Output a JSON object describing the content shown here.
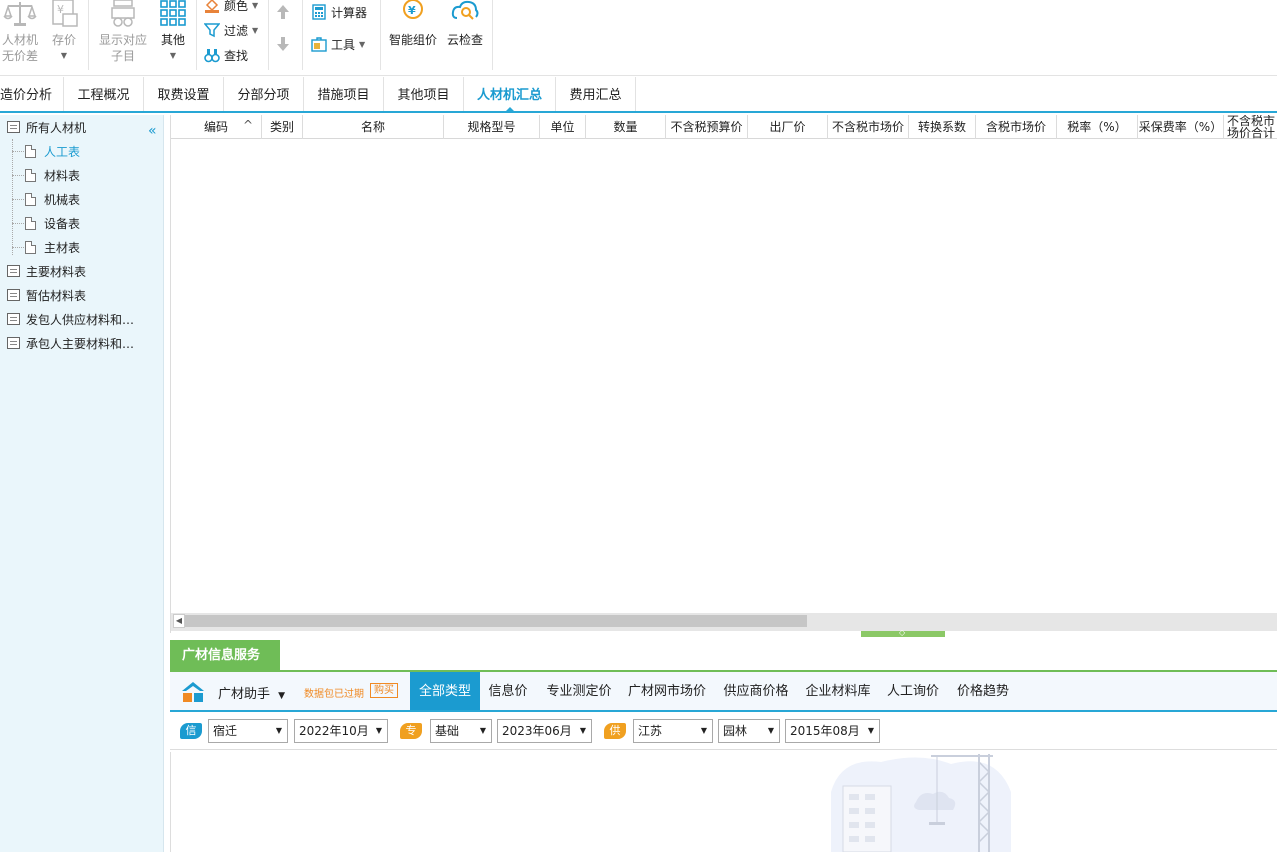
{
  "ribbon": {
    "rc_no_price_diff": [
      "人材机",
      "无价差"
    ],
    "save_price": "存价",
    "show_sub": [
      "显示对应",
      "子目"
    ],
    "other": "其他",
    "color": "颜色",
    "filter": "过滤",
    "find": "查找",
    "calculator": "计算器",
    "tools": "工具",
    "smart_price": "智能组价",
    "cloud_check": "云检查"
  },
  "tabs": [
    "造价分析",
    "工程概况",
    "取费设置",
    "分部分项",
    "措施项目",
    "其他项目",
    "人材机汇总",
    "费用汇总"
  ],
  "active_tab": "人材机汇总",
  "tree": {
    "root": "所有人材机",
    "children": [
      "人工表",
      "材料表",
      "机械表",
      "设备表",
      "主材表"
    ],
    "selected": "人工表",
    "others": [
      "主要材料表",
      "暂估材料表",
      "发包人供应材料和…",
      "承包人主要材料和…"
    ]
  },
  "grid": {
    "columns": [
      "编码",
      "类别",
      "名称",
      "规格型号",
      "单位",
      "数量",
      "不含税预算价",
      "出厂价",
      "不含税市场价",
      "转换系数",
      "含税市场价",
      "税率（%）",
      "采保费率（%）",
      "不含税市场价合计"
    ],
    "sort_indicator": "^"
  },
  "info_panel": {
    "tab": "广材信息服务",
    "assistant": "广材助手",
    "expired": "数据包已过期",
    "buy": "购买",
    "price_tabs": [
      "全部类型",
      "信息价",
      "专业测定价",
      "广材网市场价",
      "供应商价格",
      "企业材料库",
      "人工询价",
      "价格趋势"
    ],
    "active_price_tab": "全部类型",
    "filters": {
      "xin_badge": "信",
      "zhuan_badge": "专",
      "gong_badge": "供",
      "city": "宿迁",
      "info_month": "2022年10月",
      "zhuan_type": "基础",
      "zhuan_month": "2023年06月",
      "province": "江苏",
      "gong_type": "园林",
      "gong_month": "2015年08月"
    }
  },
  "colors": {
    "accent_blue": "#1b9bd0",
    "green": "#6fbd57",
    "orange": "#f08a24"
  }
}
